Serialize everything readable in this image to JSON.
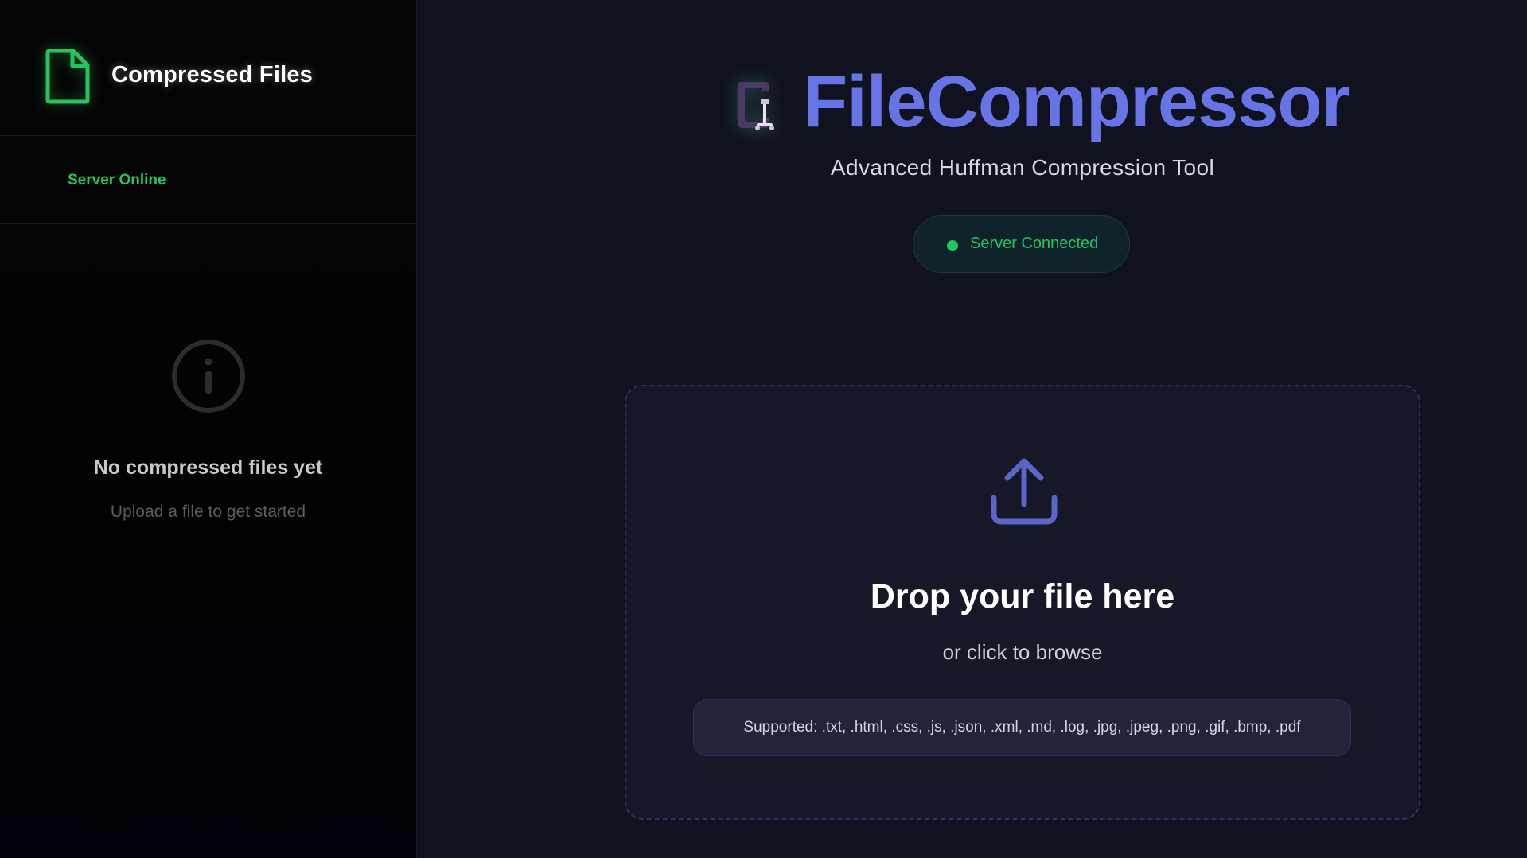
{
  "sidebar": {
    "title": "Compressed Files",
    "file_icon": "file-icon",
    "status": "Server Online",
    "empty_icon": "info-icon",
    "empty_title": "No compressed files yet",
    "empty_subtitle": "Upload a file to get started"
  },
  "main": {
    "brand_icon": "clamp-icon",
    "title": "FileCompressor",
    "subtitle": "Advanced Huffman Compression Tool",
    "connection_status": "Server Connected",
    "dropzone": {
      "icon": "upload-icon",
      "title": "Drop your file here",
      "subtitle": "or click to browse",
      "supported": "Supported: .txt, .html, .css, .js, .json, .xml, .md, .log, .jpg, .jpeg, .png, .gif, .bmp, .pdf"
    }
  },
  "colors": {
    "accent": "#6674e6",
    "success": "#22c55e",
    "sidebar_bg": "#050505",
    "main_bg": "#11121f"
  }
}
